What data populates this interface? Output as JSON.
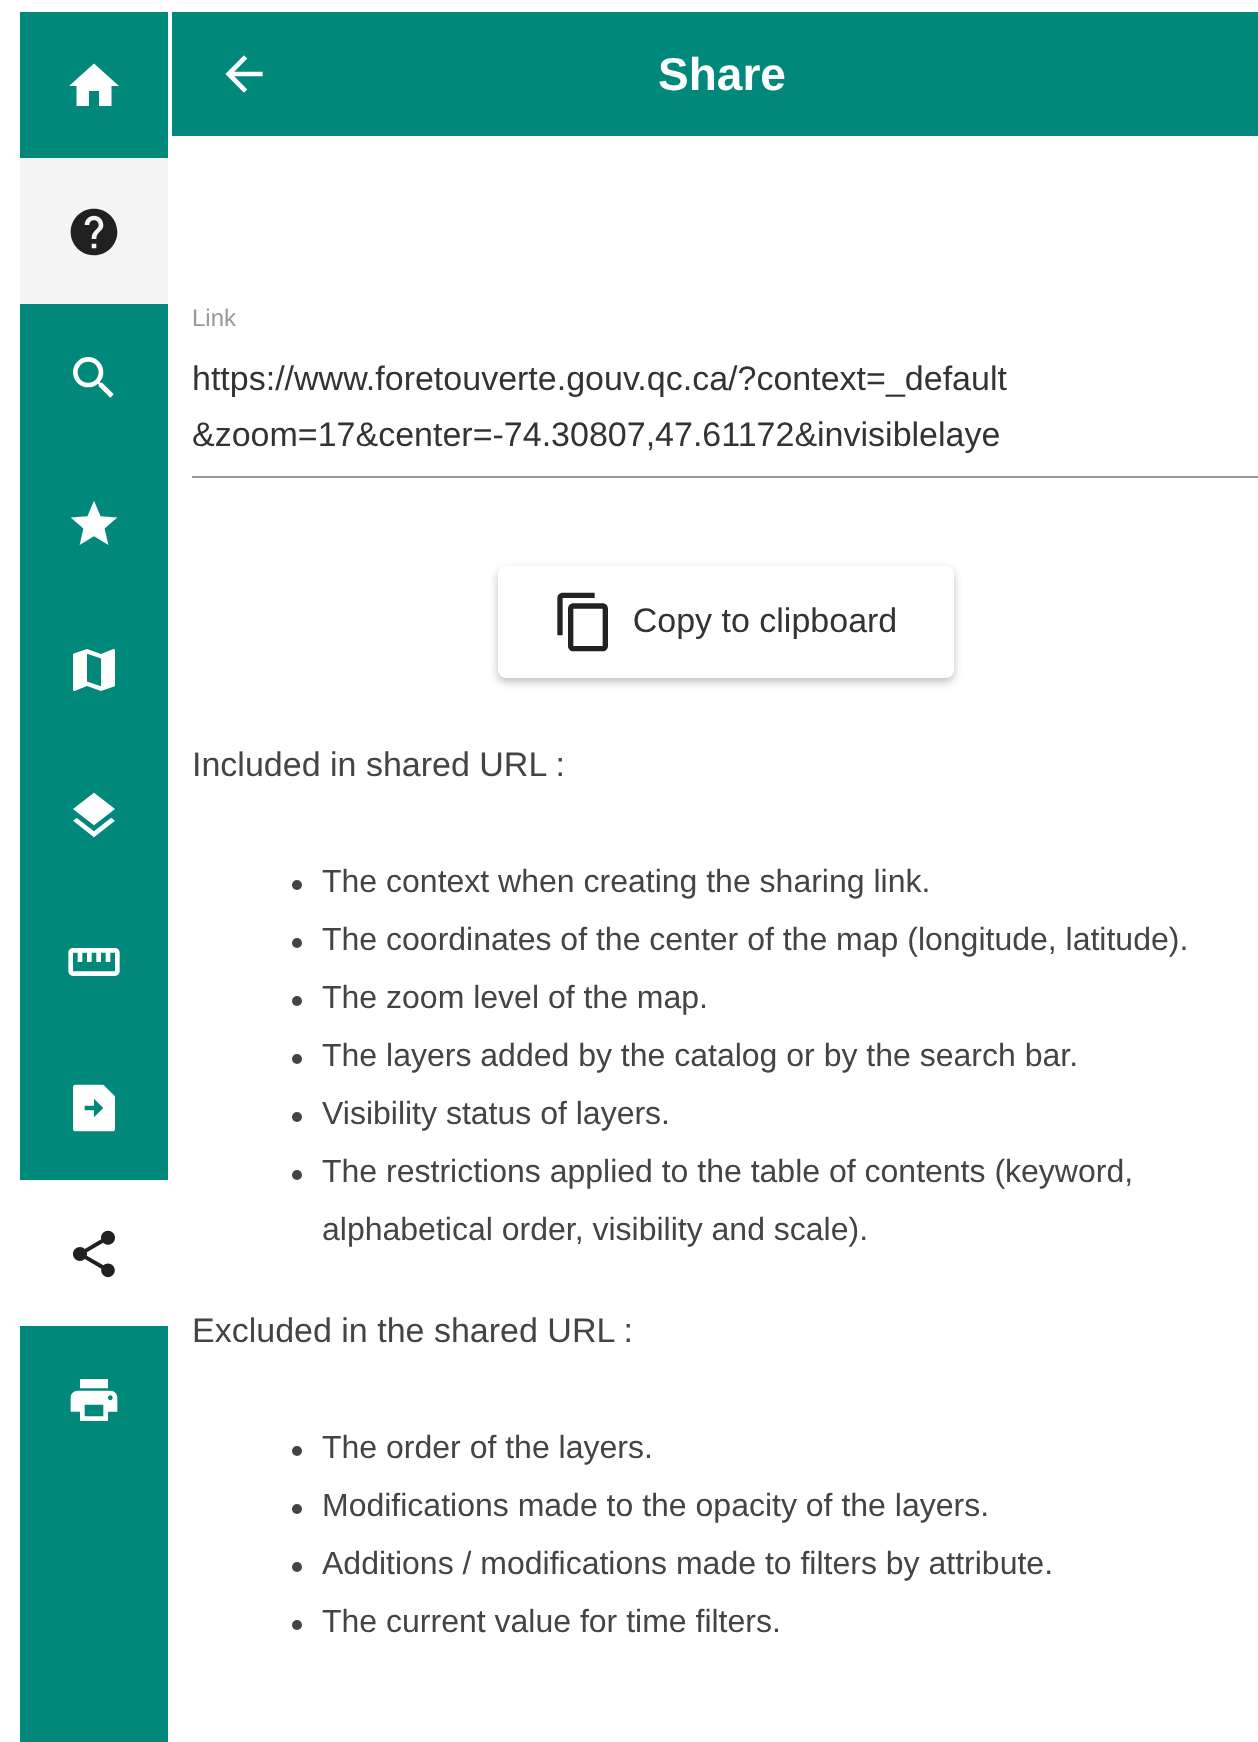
{
  "sidebar": {
    "items": [
      {
        "selected": false,
        "hovered": false
      },
      {
        "selected": false,
        "hovered": true
      },
      {
        "selected": false,
        "hovered": false
      },
      {
        "selected": false,
        "hovered": false
      },
      {
        "selected": false,
        "hovered": false
      },
      {
        "selected": false,
        "hovered": false
      },
      {
        "selected": false,
        "hovered": false
      },
      {
        "selected": false,
        "hovered": false
      },
      {
        "selected": true,
        "hovered": false
      },
      {
        "selected": false,
        "hovered": false
      }
    ]
  },
  "header": {
    "title": "Share"
  },
  "link_field": {
    "label": "Link",
    "value_lines": [
      "https://www.foretouverte.gouv.qc.ca/?context=_default",
      "&zoom=17&center=-74.30807,47.61172&invisiblelaye"
    ]
  },
  "copy_button": {
    "label": "Copy to clipboard"
  },
  "sections": [
    {
      "heading": "Included in shared URL :",
      "items": [
        "The context when creating the sharing link.",
        "The coordinates of the center of the map (longitude, latitude).",
        "The zoom level of the map.",
        "The layers added by the catalog or by the search bar.",
        "Visibility status of layers.",
        "The restrictions applied to the table of contents (keyword, alphabetical order, visibility and scale)."
      ]
    },
    {
      "heading": "Excluded in the shared URL :",
      "items": [
        "The order of the layers.",
        "Modifications made to the opacity of the layers.",
        "Additions / modifications made to filters by attribute.",
        "The current value for time filters."
      ]
    }
  ]
}
